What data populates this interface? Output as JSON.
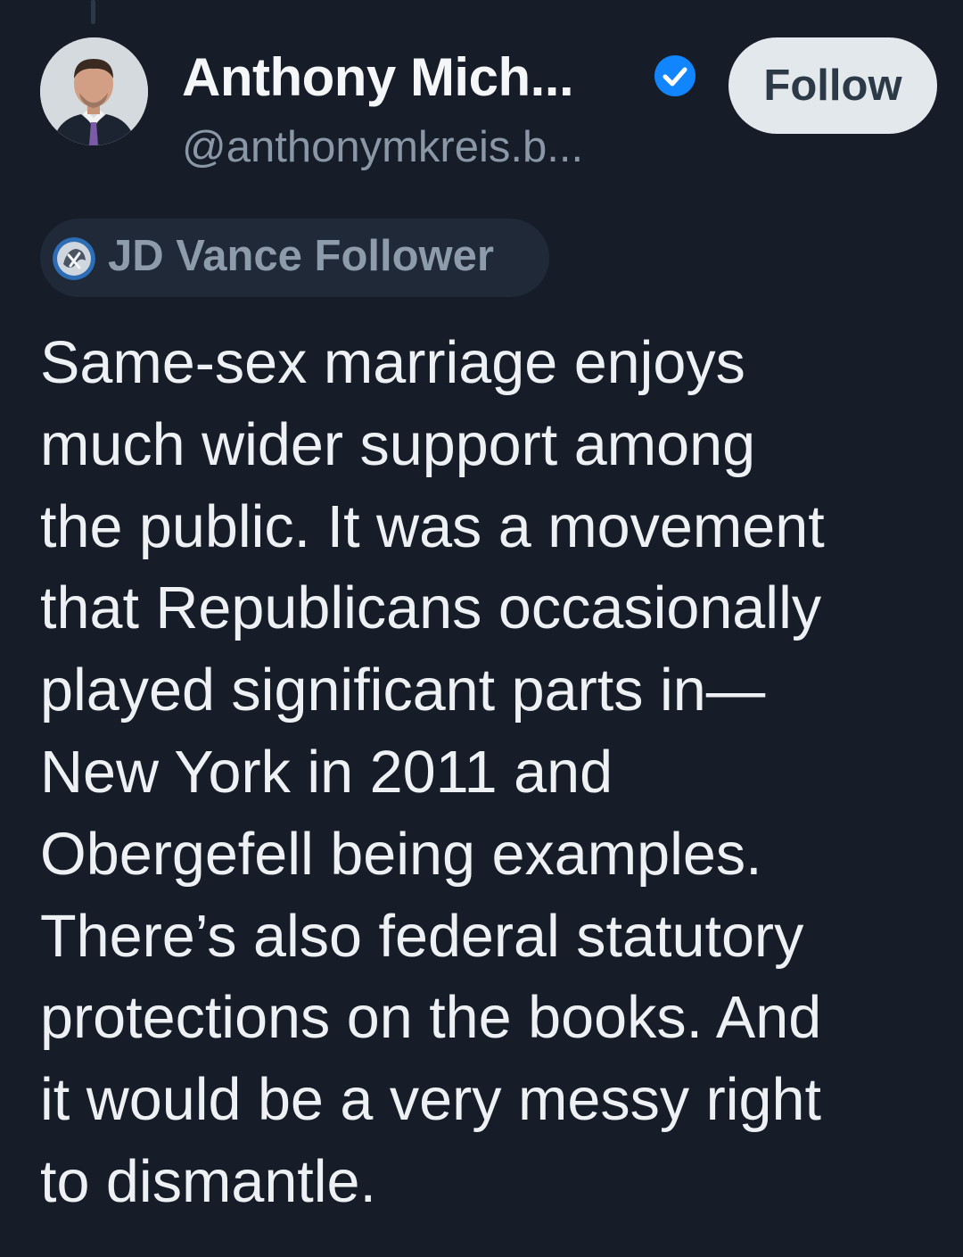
{
  "author": {
    "display_name": "Anthony Mich...",
    "handle": "@anthonymkreis.b...",
    "avatar": "avatar",
    "verified_icon": "verified-check-icon"
  },
  "follow_button": {
    "label": "Follow"
  },
  "label_badge": {
    "icon": "label-icon",
    "text": "JD Vance Follower"
  },
  "post": {
    "text": "Same-sex marriage enjoys\nmuch wider support among\nthe public. It was a movement\nthat Republicans occasionally\nplayed significant parts in—\nNew York in 2011 and\nObergefell being examples.\nThere’s also federal statutory\nprotections on the books.  And\nit would be a very messy right\nto dismantle."
  },
  "colors": {
    "background": "#161d28",
    "verified_blue": "#1185fe",
    "follow_button_bg": "#e3e8ed"
  }
}
